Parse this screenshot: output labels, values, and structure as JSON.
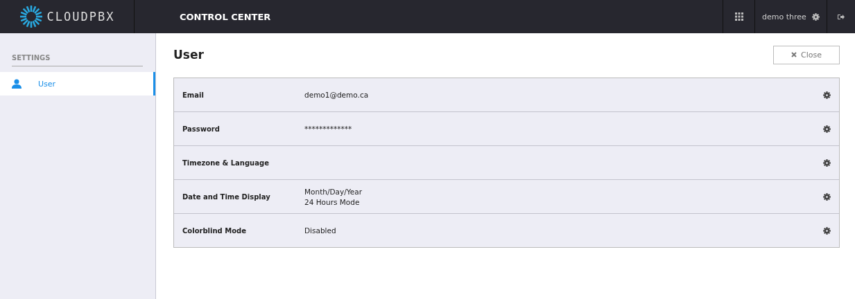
{
  "header": {
    "logo": "CLOUDPBX",
    "title": "CONTROL CENTER",
    "user": "demo three"
  },
  "sidebar": {
    "heading": "SETTINGS",
    "items": [
      {
        "label": "User",
        "selected": true
      }
    ]
  },
  "page": {
    "title": "User",
    "close_button": "Close"
  },
  "settings": [
    {
      "label": "Email",
      "values": [
        "demo1@demo.ca"
      ]
    },
    {
      "label": "Password",
      "values": [
        "*************"
      ]
    },
    {
      "label": "Timezone & Language"
    },
    {
      "label": "Date and Time Display",
      "values": [
        "Month/Day/Year",
        "24 Hours Mode"
      ]
    },
    {
      "label": "Colorblind Mode",
      "values": [
        "Disabled"
      ]
    }
  ]
}
